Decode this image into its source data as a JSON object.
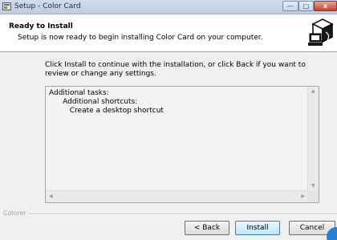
{
  "window": {
    "title": "Setup - Color Card",
    "minimize_glyph": "—",
    "maximize_glyph": "□",
    "close_glyph": "x"
  },
  "header": {
    "title": "Ready to Install",
    "subtitle": "Setup is now ready to begin installing Color Card on your computer.",
    "image_icon": "wizard-computer-box-icon"
  },
  "body": {
    "instructions": "Click Install to continue with the installation, or click Back if you want to review or change any settings.",
    "memo_lines": [
      "Additional tasks:",
      "      Additional shortcuts:",
      "         Create a desktop shortcut"
    ]
  },
  "bevel": {
    "label": "Colorer"
  },
  "buttons": {
    "back": "< Back",
    "install": "Install",
    "cancel": "Cancel"
  },
  "colors": {
    "titlebar": "#c6d5e8",
    "close_button": "#c4412d",
    "default_button_border": "#3c7fb1"
  }
}
